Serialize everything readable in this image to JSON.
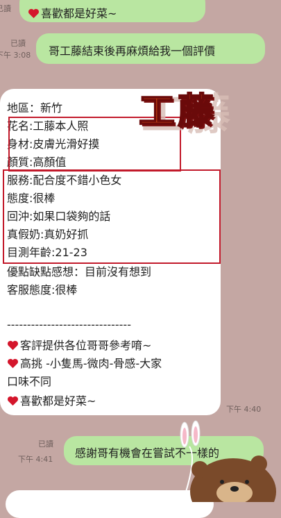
{
  "messages": {
    "top_bubble_text": "喜歡都是好菜~",
    "top_partial_meta": "已讀",
    "msg1": {
      "read": "已讀",
      "time": "下午 3:08",
      "text": "哥工藤結束後再麻煩給我一個評價"
    },
    "sticker": {
      "text": "工藤"
    },
    "review": {
      "lines": [
        "地區：新竹",
        "花名:工藤本人照",
        "身材:皮膚光滑好摸",
        "顏質:高顏值",
        "服務:配合度不錯小色女",
        "態度:很棒",
        "回沖:如果口袋夠的話",
        "真假奶:真奶好抓",
        "目測年齡:21-23",
        "優點缺點感想：目前沒有想到",
        "客服態度:很棒",
        "",
        "-------------------------------",
        "客評提供各位哥哥參考唷~",
        "高挑 -小隻馬-微肉-骨感-大家",
        "口味不同",
        "喜歡都是好菜~"
      ],
      "time": "下午 4:40"
    },
    "msg2": {
      "read": "已讀",
      "time": "下午 4:41",
      "text": "感謝哥有機會在嘗試不一樣的"
    }
  },
  "colors": {
    "chat_bg": "#c4a7a3",
    "green_bubble": "#b9e6a1",
    "highlight_box": "#c2192a",
    "heart": "#d4162c"
  }
}
